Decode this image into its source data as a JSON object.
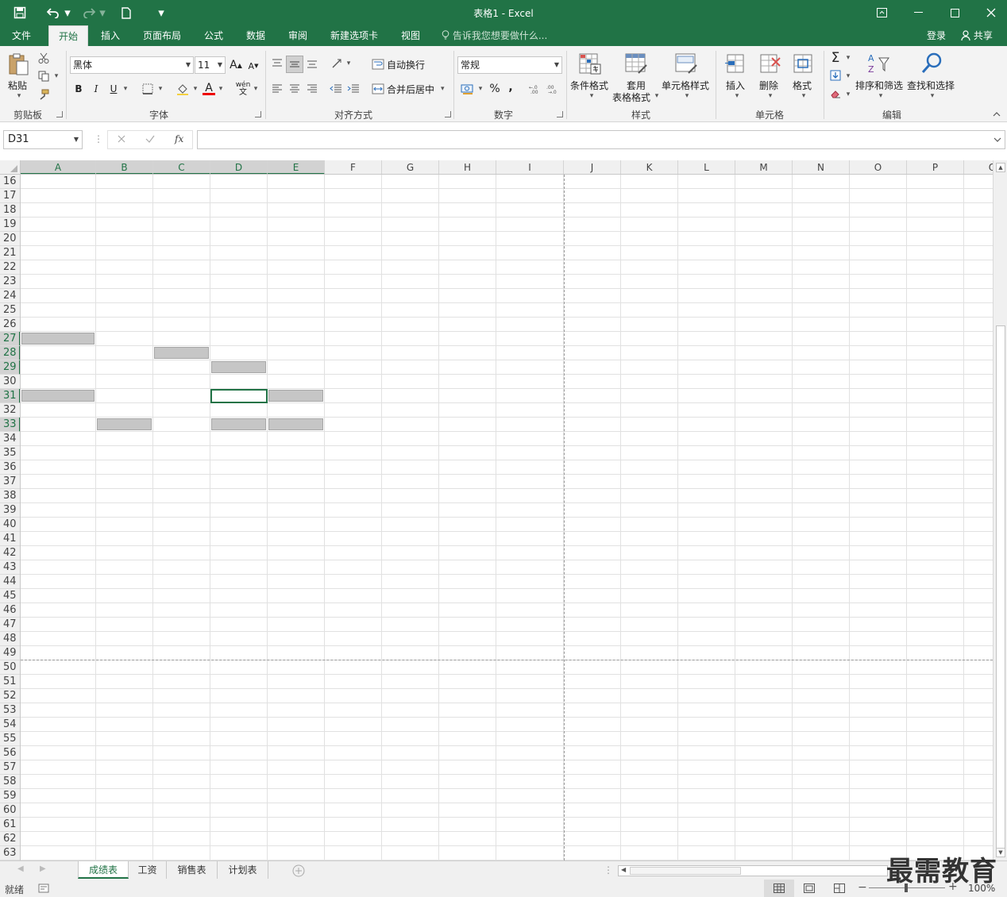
{
  "window": {
    "title": "表格1 - Excel",
    "quick_access": [
      "save-icon",
      "undo-icon",
      "redo-icon",
      "new-file-icon",
      "customize-icon"
    ],
    "minimize": "—",
    "restore": "☐",
    "close": "✕",
    "ribbon_display": "⊡"
  },
  "tabs": [
    {
      "label": "文件"
    },
    {
      "label": "开始"
    },
    {
      "label": "插入"
    },
    {
      "label": "页面布局"
    },
    {
      "label": "公式"
    },
    {
      "label": "数据"
    },
    {
      "label": "审阅"
    },
    {
      "label": "新建选项卡"
    },
    {
      "label": "视图"
    }
  ],
  "active_tab": "开始",
  "tell_me": "告诉我您想要做什么...",
  "login": "登录",
  "share": "共享",
  "ribbon": {
    "clipboard": {
      "label": "剪贴板",
      "paste": "粘贴"
    },
    "font": {
      "label": "字体",
      "font_name": "黑体",
      "font_size": "11",
      "bold": "B",
      "italic": "I",
      "underline": "U",
      "grow": "A",
      "shrink": "A",
      "font_color": "A",
      "phonetic": "wén"
    },
    "alignment": {
      "label": "对齐方式",
      "wrap": "自动换行",
      "merge": "合并后居中"
    },
    "number": {
      "label": "数字",
      "format": "常规",
      "percent": "%",
      "comma": ","
    },
    "styles": {
      "label": "样式",
      "conditional": "条件格式",
      "table_format_1": "套用",
      "table_format_2": "表格格式",
      "cell_styles": "单元格样式"
    },
    "cells": {
      "label": "单元格",
      "insert": "插入",
      "delete": "删除",
      "format": "格式"
    },
    "editing": {
      "label": "编辑",
      "sort_filter": "排序和筛选",
      "find_select": "查找和选择",
      "sigma": "Σ"
    }
  },
  "formula_bar": {
    "name_box": "D31",
    "fx": "fx",
    "formula": ""
  },
  "columns": [
    "A",
    "B",
    "C",
    "D",
    "E",
    "F",
    "G",
    "H",
    "I",
    "J",
    "K",
    "L",
    "M",
    "N",
    "O",
    "P",
    "Q"
  ],
  "selected_columns": [
    "A",
    "B",
    "C",
    "D",
    "E"
  ],
  "rows": [
    "16",
    "17",
    "18",
    "19",
    "20",
    "21",
    "22",
    "23",
    "24",
    "25",
    "26",
    "27",
    "28",
    "29",
    "30",
    "31",
    "32",
    "33",
    "34",
    "35",
    "36",
    "37",
    "38",
    "39",
    "40",
    "41",
    "42",
    "43",
    "44",
    "45",
    "46",
    "47",
    "48",
    "49",
    "50",
    "51",
    "52",
    "53",
    "54",
    "55",
    "56",
    "57",
    "58",
    "59",
    "60",
    "61",
    "62",
    "63"
  ],
  "selected_rows": [
    "27",
    "28",
    "29",
    "31",
    "33"
  ],
  "selected_cells": [
    "A27",
    "C28",
    "D29",
    "A31",
    "D31",
    "E31",
    "B33",
    "D33",
    "E33"
  ],
  "active_cell": "D31",
  "sheets": [
    {
      "label": "成绩表"
    },
    {
      "label": "工资"
    },
    {
      "label": "销售表"
    },
    {
      "label": "计划表"
    }
  ],
  "active_sheet": "成绩表",
  "status": {
    "ready": "就绪",
    "zoom": "100%"
  },
  "watermark": "最需教育",
  "colors": {
    "brand": "#217346",
    "selection": "#c6c6c6"
  }
}
